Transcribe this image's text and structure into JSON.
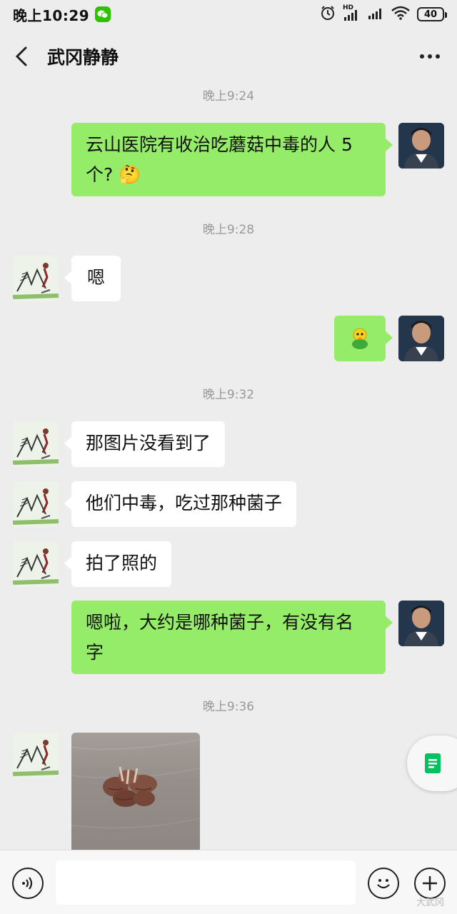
{
  "status_bar": {
    "time": "晚上10:29",
    "network": "HD",
    "battery": "40"
  },
  "header": {
    "title": "武冈静静"
  },
  "messages": [
    {
      "type": "time",
      "text": "晚上9:24"
    },
    {
      "type": "text",
      "direction": "out",
      "text_line1": "云山医院有收治吃蘑菇中毒的人 5",
      "text_line2": "个? 🤔"
    },
    {
      "type": "time",
      "text": "晚上9:28"
    },
    {
      "type": "text",
      "direction": "in",
      "text": "嗯"
    },
    {
      "type": "sticker",
      "direction": "out",
      "icon": "green-chick-emoji"
    },
    {
      "type": "time",
      "text": "晚上9:32"
    },
    {
      "type": "text",
      "direction": "in",
      "text": "那图片没看到了"
    },
    {
      "type": "text",
      "direction": "in",
      "text": "他们中毒，吃过那种菌子"
    },
    {
      "type": "text",
      "direction": "in",
      "text": "拍了照的"
    },
    {
      "type": "text",
      "direction": "out",
      "text_line1": "嗯啦，大约是哪种菌子，有没有名",
      "text_line2": "字"
    },
    {
      "type": "time",
      "text": "晚上9:36"
    },
    {
      "type": "image",
      "direction": "in",
      "description_icon": "mushroom-photo"
    }
  ],
  "input_bar": {
    "placeholder": ""
  },
  "watermark": "大武冈",
  "colors": {
    "outgoing_bubble": "#95ec69",
    "incoming_bubble": "#ffffff",
    "background": "#ededed",
    "wechat_green": "#2dc100"
  }
}
